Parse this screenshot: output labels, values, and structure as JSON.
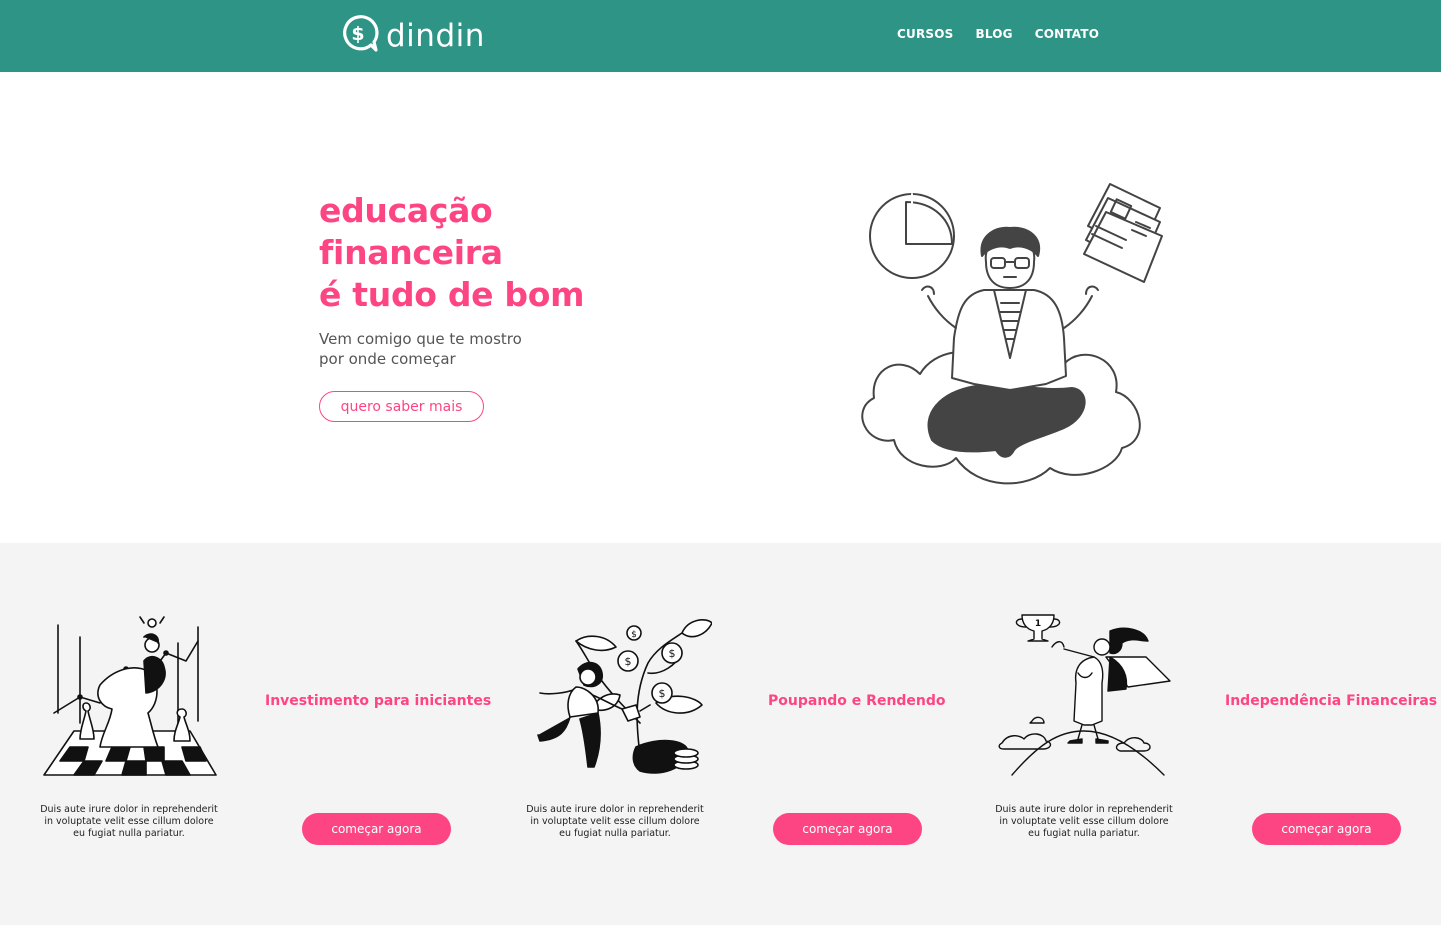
{
  "header": {
    "logo_text": "dindin",
    "nav": [
      "CURSOS",
      "BLOG",
      "CONTATO"
    ]
  },
  "hero": {
    "title_lines": [
      "educação",
      "financeira",
      "é tudo de bom"
    ],
    "subtitle_lines": [
      "Vem comigo que te mostro",
      "por onde começar"
    ],
    "button_label": "quero saber mais"
  },
  "cards": [
    {
      "title": "Investimento para iniciantes",
      "text": "Duis aute irure dolor in reprehenderit in voluptate velit esse cillum dolore eu fugiat nulla pariatur.",
      "button_label": "começar agora"
    },
    {
      "title": "Poupando e Rendendo",
      "text": "Duis aute irure dolor in reprehenderit in voluptate velit esse cillum dolore eu fugiat nulla pariatur.",
      "button_label": "começar agora"
    },
    {
      "title": "Independência Financeiras",
      "text": "Duis aute irure dolor in reprehenderit in voluptate velit esse cillum dolore eu fugiat nulla pariatur.",
      "button_label": "começar agora"
    }
  ],
  "colors": {
    "header_bg": "#2e9486",
    "accent_pink": "#fe4583",
    "cards_bg": "#f4f4f4"
  },
  "icons": [
    "dollar-logo-icon",
    "meditating-person-illustration",
    "chess-horse-illustration",
    "money-plant-illustration",
    "trophy-hero-illustration"
  ]
}
